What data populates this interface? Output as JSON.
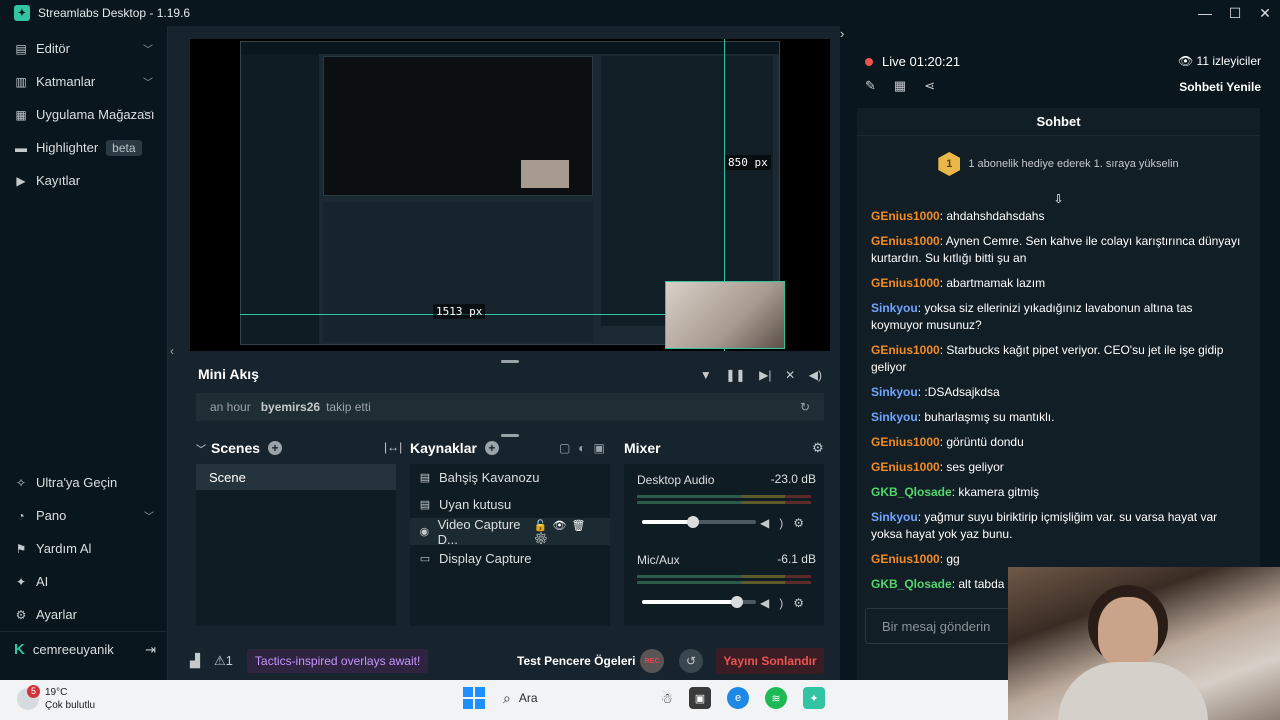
{
  "app": {
    "title": "Streamlabs Desktop - 1.19.6"
  },
  "sidebar": {
    "items": [
      {
        "label": "Editör",
        "icon": "editor-icon"
      },
      {
        "label": "Katmanlar",
        "icon": "layers-icon"
      },
      {
        "label": "Uygulama Mağazası",
        "icon": "store-icon"
      },
      {
        "label": "Highlighter",
        "icon": "highlighter-icon",
        "badge": "beta"
      },
      {
        "label": "Kayıtlar",
        "icon": "recordings-icon"
      }
    ],
    "bottom": [
      {
        "label": "Ultra'ya Geçin",
        "icon": "ultra-icon"
      },
      {
        "label": "Pano",
        "icon": "dashboard-icon"
      },
      {
        "label": "Yardım Al",
        "icon": "help-icon"
      },
      {
        "label": "AI",
        "icon": "ai-icon"
      },
      {
        "label": "Ayarlar",
        "icon": "settings-icon"
      }
    ],
    "user": "cemreeuyanik"
  },
  "preview": {
    "measure_h": "1513 px",
    "measure_v": "850 px"
  },
  "miniflow": {
    "title": "Mini Akış",
    "time": "an hour",
    "user": "byemirs26",
    "action": "takip etti"
  },
  "scenes": {
    "title": "Scenes",
    "items": [
      "Scene"
    ]
  },
  "sources": {
    "title": "Kaynaklar",
    "items": [
      "Bahşiş Kavanozu",
      "Uyan kutusu",
      "Video Capture D...",
      "Display Capture"
    ]
  },
  "mixer": {
    "title": "Mixer",
    "channels": [
      {
        "name": "Desktop Audio",
        "db": "-23.0 dB",
        "level": 0.45
      },
      {
        "name": "Mic/Aux",
        "db": "-6.1 dB",
        "level": 0.83
      }
    ]
  },
  "footer": {
    "promo": "Tactics-inspired overlays await!",
    "alert_count": "1",
    "test_label": "Test Pencere Ögeleri",
    "rec_label": "REC",
    "end_label": "Yayını Sonlandır"
  },
  "chat": {
    "live": "Live 01:20:21",
    "viewers": "11 izleyiciler",
    "refresh": "Sohbeti Yenile",
    "header": "Sohbet",
    "pinned_rank": "1",
    "pinned": "1 abonelik hediye ederek 1. sıraya yükselin",
    "input_placeholder": "Bir mesaj gönderin",
    "messages": [
      {
        "user": "GEnius1000",
        "color": "orange",
        "text": "ahdahshdahsdahs"
      },
      {
        "user": "GEnius1000",
        "color": "orange",
        "text": "Aynen Cemre. Sen kahve ile colayı karıştırınca dünyayı kurtardın. Su kıtlığı bitti şu an"
      },
      {
        "user": "GEnius1000",
        "color": "orange",
        "text": "abartmamak lazım"
      },
      {
        "user": "Sinkyou",
        "color": "blue",
        "text": "yoksa siz ellerinizi yıkadığınız lavabonun altına tas koymuyor musunuz?"
      },
      {
        "user": "GEnius1000",
        "color": "orange",
        "text": "Starbucks kağıt pipet veriyor. CEO'su jet ile işe gidip geliyor"
      },
      {
        "user": "Sinkyou",
        "color": "blue",
        "text": ":DSAdsajkdsa"
      },
      {
        "user": "Sinkyou",
        "color": "blue",
        "text": "buharlaşmış su mantıklı."
      },
      {
        "user": "GEnius1000",
        "color": "orange",
        "text": "görüntü dondu"
      },
      {
        "user": "GEnius1000",
        "color": "orange",
        "text": "ses geliyor"
      },
      {
        "user": "GKB_Qlosade",
        "color": "green",
        "text": "kkamera gitmiş"
      },
      {
        "user": "Sinkyou",
        "color": "blue",
        "text": "yağmur suyu biriktirip içmişliğim var. su varsa hayat var yoksa hayat yok yaz bunu."
      },
      {
        "user": "GEnius1000",
        "color": "orange",
        "text": "gg"
      },
      {
        "user": "GKB_Qlosade",
        "color": "green",
        "text": "alt tabda dir"
      }
    ]
  },
  "taskbar": {
    "weather_temp": "19°C",
    "weather_desc": "Çok bulutlu",
    "weather_badge": "5",
    "search": "Ara"
  },
  "colors": {
    "accent": "#31c3a2",
    "live_red": "#ef5350",
    "promo_purple": "#c596ff"
  }
}
